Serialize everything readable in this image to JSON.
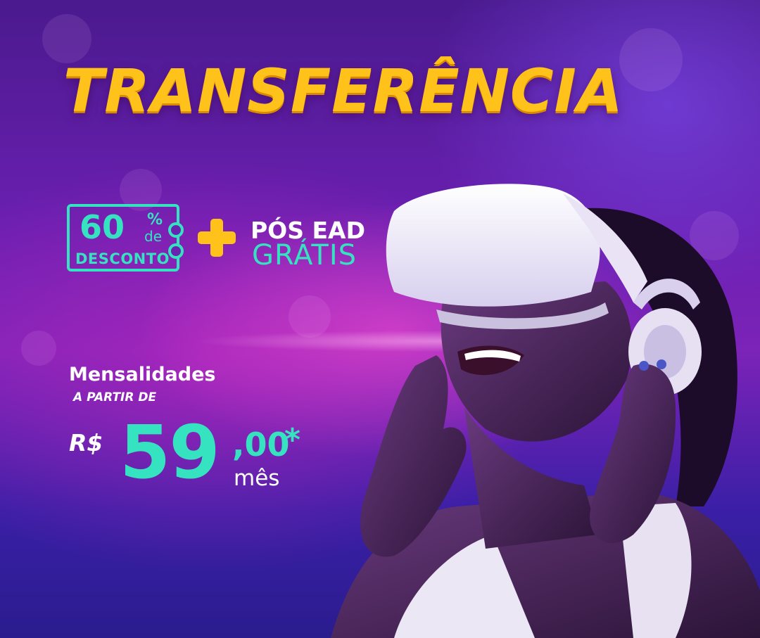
{
  "banner": {
    "title": "TRANSFERÊNCIA",
    "coupon": {
      "number": "60",
      "percent_sign": "%",
      "de": "de",
      "label": "DESCONTO"
    },
    "plus_icon": "plus-icon",
    "pos_ead": "PÓS EAD",
    "gratis": "GRÁTIS",
    "mensalidades": "Mensalidades",
    "a_partir_de": "A PARTIR DE",
    "currency": "R$",
    "price_integer": "59",
    "price_decimal": ",00",
    "asterisk": "*",
    "per_month": "mês"
  },
  "colors": {
    "title": "#ffc21a",
    "accent_teal": "#35e3c0",
    "plus": "#ffc21a",
    "background_purple": "#6a1fb0"
  }
}
